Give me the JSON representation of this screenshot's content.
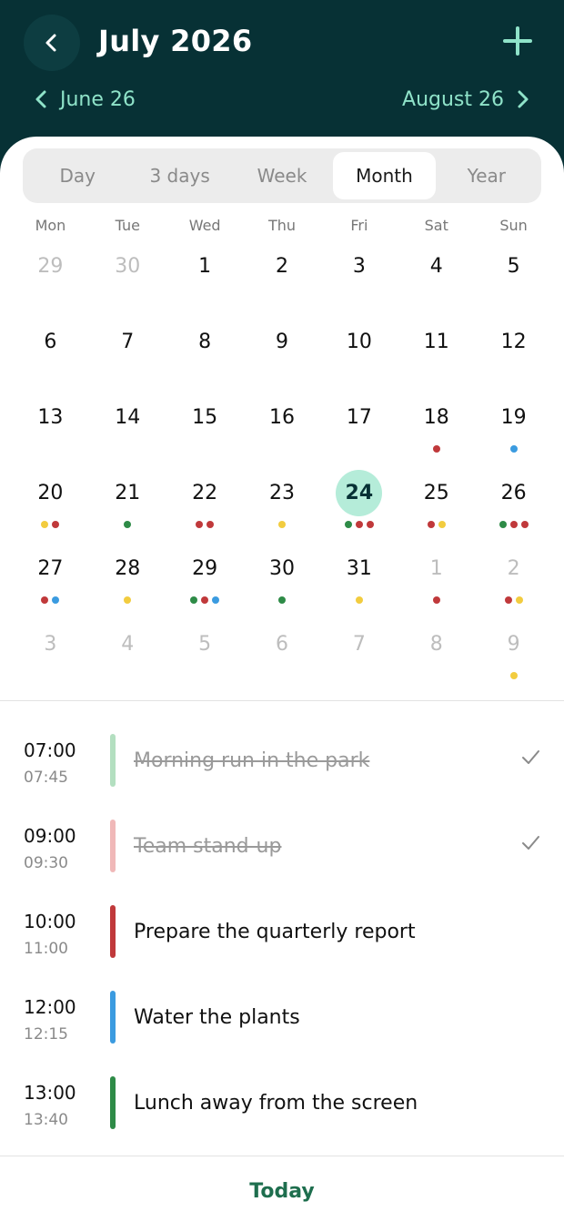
{
  "header": {
    "title": "July 2026",
    "prev_month_label": "June 26",
    "next_month_label": "August 26"
  },
  "view_tabs": [
    {
      "label": "Day",
      "active": false
    },
    {
      "label": "3 days",
      "active": false
    },
    {
      "label": "Week",
      "active": false
    },
    {
      "label": "Month",
      "active": true
    },
    {
      "label": "Year",
      "active": false
    }
  ],
  "weekdays": [
    "Mon",
    "Tue",
    "Wed",
    "Thu",
    "Fri",
    "Sat",
    "Sun"
  ],
  "colors": {
    "red": "#c0393b",
    "green": "#2e8b47",
    "blue": "#3b9be0",
    "yellow": "#f2cc3f",
    "accent": "#8fe3c9",
    "header_bg": "#073135"
  },
  "calendar": {
    "weeks": [
      [
        {
          "d": "29",
          "m": true,
          "dots": []
        },
        {
          "d": "30",
          "m": true,
          "dots": []
        },
        {
          "d": "1",
          "dots": []
        },
        {
          "d": "2",
          "dots": []
        },
        {
          "d": "3",
          "dots": []
        },
        {
          "d": "4",
          "dots": []
        },
        {
          "d": "5",
          "dots": []
        }
      ],
      [
        {
          "d": "6",
          "dots": []
        },
        {
          "d": "7",
          "dots": []
        },
        {
          "d": "8",
          "dots": []
        },
        {
          "d": "9",
          "dots": []
        },
        {
          "d": "10",
          "dots": []
        },
        {
          "d": "11",
          "dots": []
        },
        {
          "d": "12",
          "dots": []
        }
      ],
      [
        {
          "d": "13",
          "dots": []
        },
        {
          "d": "14",
          "dots": []
        },
        {
          "d": "15",
          "dots": []
        },
        {
          "d": "16",
          "dots": []
        },
        {
          "d": "17",
          "dots": []
        },
        {
          "d": "18",
          "dots": [
            "red"
          ]
        },
        {
          "d": "19",
          "dots": [
            "blue"
          ]
        }
      ],
      [
        {
          "d": "20",
          "dots": [
            "yellow",
            "red"
          ]
        },
        {
          "d": "21",
          "dots": [
            "green"
          ]
        },
        {
          "d": "22",
          "dots": [
            "red",
            "red"
          ]
        },
        {
          "d": "23",
          "dots": [
            "yellow"
          ]
        },
        {
          "d": "24",
          "today": true,
          "dots": [
            "green",
            "red",
            "red"
          ]
        },
        {
          "d": "25",
          "dots": [
            "red",
            "yellow"
          ]
        },
        {
          "d": "26",
          "dots": [
            "green",
            "red",
            "red"
          ]
        }
      ],
      [
        {
          "d": "27",
          "dots": [
            "red",
            "blue"
          ]
        },
        {
          "d": "28",
          "dots": [
            "yellow"
          ]
        },
        {
          "d": "29",
          "dots": [
            "green",
            "red",
            "blue"
          ]
        },
        {
          "d": "30",
          "dots": [
            "green"
          ]
        },
        {
          "d": "31",
          "dots": [
            "yellow"
          ]
        },
        {
          "d": "1",
          "m": true,
          "dots": [
            "red"
          ]
        },
        {
          "d": "2",
          "m": true,
          "dots": [
            "red",
            "yellow"
          ]
        }
      ],
      [
        {
          "d": "3",
          "m": true,
          "dots": []
        },
        {
          "d": "4",
          "m": true,
          "dots": []
        },
        {
          "d": "5",
          "m": true,
          "dots": []
        },
        {
          "d": "6",
          "m": true,
          "dots": []
        },
        {
          "d": "7",
          "m": true,
          "dots": []
        },
        {
          "d": "8",
          "m": true,
          "dots": []
        },
        {
          "d": "9",
          "m": true,
          "dots": [
            "yellow"
          ]
        }
      ]
    ]
  },
  "events": [
    {
      "start": "07:00",
      "end": "07:45",
      "title": "Morning run in the park",
      "color": "#b3dfc0",
      "done": true
    },
    {
      "start": "09:00",
      "end": "09:30",
      "title": "Team stand-up",
      "color": "#f0b8b8",
      "done": true
    },
    {
      "start": "10:00",
      "end": "11:00",
      "title": "Prepare the quarterly report",
      "color": "#c0393b",
      "done": false
    },
    {
      "start": "12:00",
      "end": "12:15",
      "title": "Water the plants",
      "color": "#3b9be0",
      "done": false
    },
    {
      "start": "13:00",
      "end": "13:40",
      "title": "Lunch away from the screen",
      "color": "#2e8b47",
      "done": false
    }
  ],
  "footer": {
    "today_label": "Today"
  },
  "icons": {
    "back": "chevron-left-icon",
    "add": "plus-icon",
    "prev": "chevron-left-icon",
    "next": "chevron-right-icon",
    "check": "checkmark-icon"
  }
}
